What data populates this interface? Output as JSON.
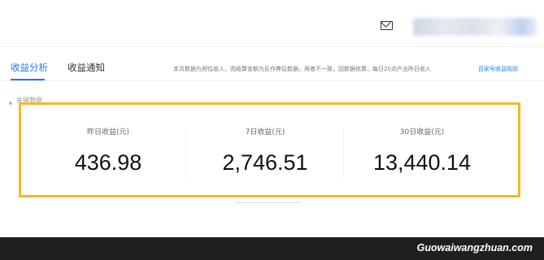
{
  "header": {
    "mail_icon": "mail-icon"
  },
  "tabs": [
    {
      "label": "收益分析",
      "active": true
    },
    {
      "label": "收益通知",
      "active": false
    }
  ],
  "notice": {
    "text": "本页数据为预估收入，而结算金额为反作弊后数据，两者不一致，因数据核算，每日20点产出昨日收入",
    "link": "百家号收益规则"
  },
  "section": {
    "title": "关键数据"
  },
  "stats": [
    {
      "label": "昨日收益(元)",
      "value": "436.98"
    },
    {
      "label": "7日收益(元)",
      "value": "2,746.51"
    },
    {
      "label": "30日收益(元)",
      "value": "13,440.14"
    }
  ],
  "colors": {
    "accent": "#1f7cf0",
    "highlight_border": "#f5b820"
  },
  "watermark": {
    "text": "Guowaiwangzhuan.com"
  }
}
